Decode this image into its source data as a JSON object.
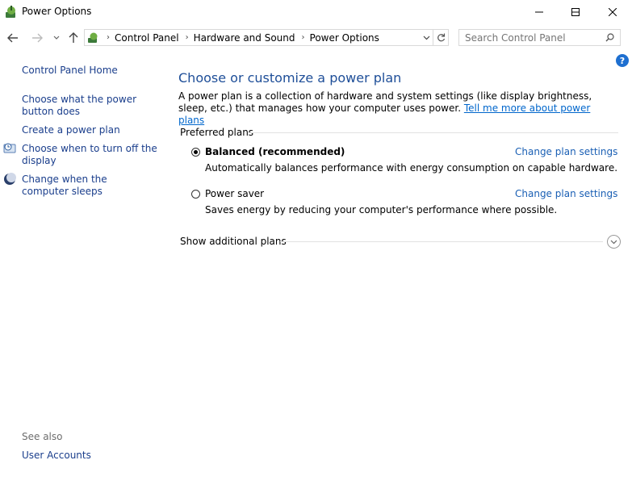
{
  "window": {
    "title": "Power Options",
    "controls": {
      "minimize": "minimize-icon",
      "maximize": "maximize-icon",
      "close": "close-icon"
    }
  },
  "nav": {
    "breadcrumbs": [
      "Control Panel",
      "Hardware and Sound",
      "Power Options"
    ],
    "search_placeholder": "Search Control Panel"
  },
  "sidebar": {
    "home": "Control Panel Home",
    "links": [
      "Choose what the power button does",
      "Create a power plan",
      "Choose when to turn off the display",
      "Change when the computer sleeps"
    ],
    "see_also_label": "See also",
    "see_also_links": [
      "User Accounts"
    ]
  },
  "main": {
    "heading": "Choose or customize a power plan",
    "description": "A power plan is a collection of hardware and system settings (like display brightness, sleep, etc.) that manages how your computer uses power.",
    "learn_more": "Tell me more about power plans",
    "preferred_label": "Preferred plans",
    "plans": [
      {
        "name": "Balanced (recommended)",
        "description": "Automatically balances performance with energy consumption on capable hardware.",
        "selected": true,
        "change_label": "Change plan settings"
      },
      {
        "name": "Power saver",
        "description": "Saves energy by reducing your computer's performance where possible.",
        "selected": false,
        "change_label": "Change plan settings"
      }
    ],
    "additional_label": "Show additional plans"
  },
  "colors": {
    "link": "#1a3e8c",
    "heading": "#1e4e98",
    "accent": "#1e6fd0"
  }
}
